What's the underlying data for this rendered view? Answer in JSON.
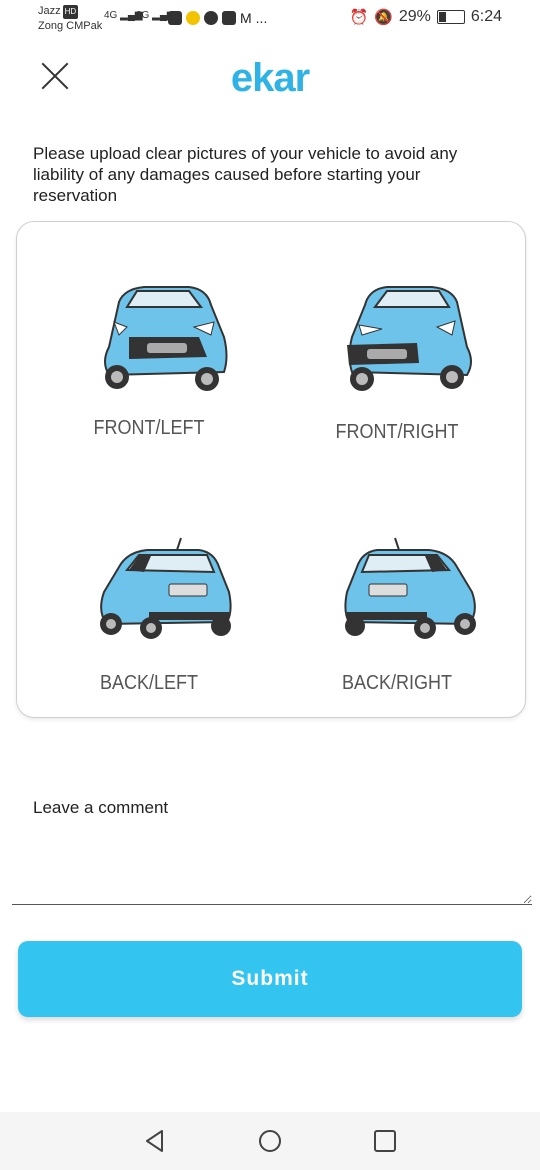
{
  "status_bar": {
    "carrier1": "Jazz",
    "carrier1_badge": "HD",
    "carrier2": "Zong CMPak",
    "sig1": "4G",
    "sig2": "3G",
    "more": "...",
    "battery": "29%",
    "time": "6:24"
  },
  "header": {
    "logo": "ekar"
  },
  "instructions": "Please upload clear pictures of your vehicle to avoid any liability of any damages caused before starting your reservation",
  "photos": [
    {
      "label": "FRONT/LEFT"
    },
    {
      "label": "FRONT/RIGHT"
    },
    {
      "label": "BACK/LEFT"
    },
    {
      "label": "BACK/RIGHT"
    }
  ],
  "comment": {
    "label": "Leave a comment",
    "value": "",
    "placeholder": ""
  },
  "submit_label": "Submit",
  "colors": {
    "brand": "#2fb3e7",
    "button": "#34c4f0",
    "car_body": "#6dc3ea"
  }
}
